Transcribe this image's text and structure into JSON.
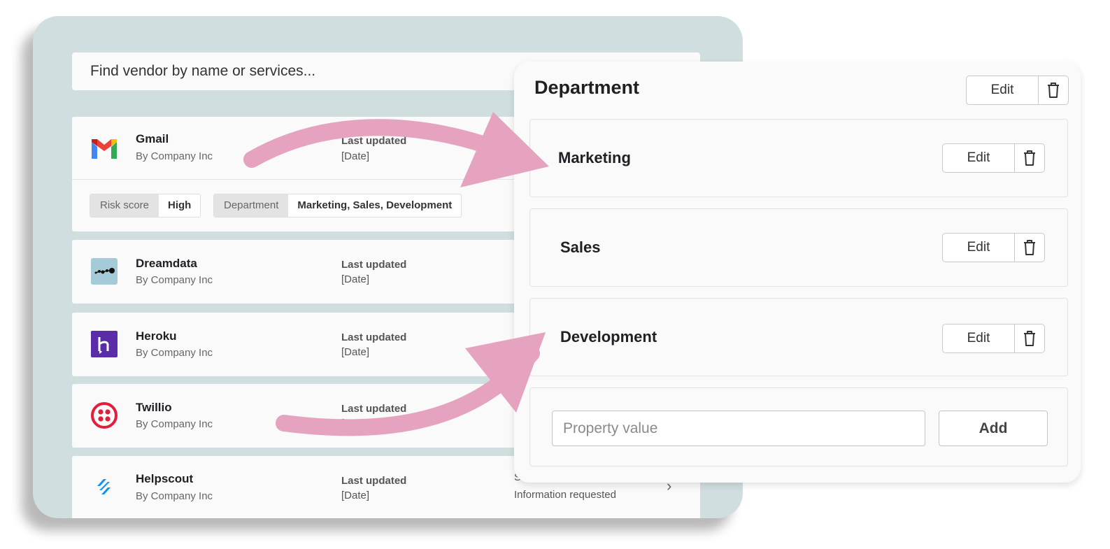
{
  "search": {
    "placeholder": "Find vendor by name or services..."
  },
  "vendors": [
    {
      "name": "Gmail",
      "by": "By Company Inc",
      "updated_label": "Last updated",
      "updated_value": "[Date]",
      "logo": "gmail-icon"
    },
    {
      "name": "Dreamdata",
      "by": "By Company Inc",
      "updated_label": "Last updated",
      "updated_value": "[Date]",
      "logo": "dreamdata-icon"
    },
    {
      "name": "Heroku",
      "by": "By Company Inc",
      "updated_label": "Last updated",
      "updated_value": "[Date]",
      "logo": "heroku-icon"
    },
    {
      "name": "Twillio",
      "by": "By Company Inc",
      "updated_label": "Last updated",
      "updated_value": "[Date]",
      "logo": "twilio-icon"
    },
    {
      "name": "Helpscout",
      "by": "By Company Inc",
      "updated_label": "Last updated",
      "updated_value": "[Date]",
      "status_label": "Status",
      "status_value": "Information requested",
      "logo": "helpscout-icon"
    }
  ],
  "tags": [
    {
      "key": "Risk score",
      "value": "High"
    },
    {
      "key": "Department",
      "value": "Marketing, Sales, Development"
    }
  ],
  "department": {
    "title": "Department",
    "edit_label": "Edit",
    "items": [
      {
        "label": "Marketing"
      },
      {
        "label": "Sales"
      },
      {
        "label": "Development"
      }
    ],
    "input_placeholder": "Property value",
    "add_label": "Add"
  },
  "colors": {
    "panel_bg": "#d0dedf",
    "arrow": "#e6a3c0",
    "heroku": "#5a2ca8",
    "twilio": "#e31e3a",
    "helpscout": "#1292ee",
    "dreamdata": "#a5cbd8"
  }
}
